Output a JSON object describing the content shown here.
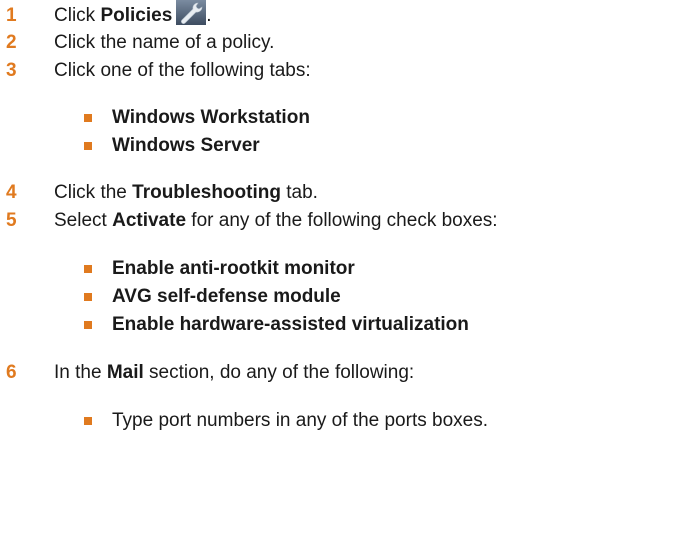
{
  "steps": [
    {
      "num": "1",
      "pre": "Click ",
      "bold": "Policies",
      "post": ".",
      "icon": "wrench-icon"
    },
    {
      "num": "2",
      "pre": "Click the name of a policy.",
      "bold": "",
      "post": ""
    },
    {
      "num": "3",
      "pre": "Click one of the following tabs:",
      "bold": "",
      "post": ""
    },
    {
      "num": "4",
      "pre": "Click the ",
      "bold": "Troubleshooting",
      "post": " tab."
    },
    {
      "num": "5",
      "pre": "Select ",
      "bold": "Activate",
      "post": " for any of the following check boxes:"
    },
    {
      "num": "6",
      "pre": "In the ",
      "bold": "Mail",
      "post": " section, do any of the following:"
    }
  ],
  "tabs_list": [
    "Windows Workstation",
    "Windows Server"
  ],
  "checkbox_list": [
    "Enable anti-rootkit monitor",
    "AVG self-defense module",
    "Enable hardware-assisted virtualization"
  ],
  "mail_list": [
    "Type port numbers in any of the ports boxes."
  ],
  "colors": {
    "number": "#e07a1f",
    "bullet": "#e07a1f"
  }
}
